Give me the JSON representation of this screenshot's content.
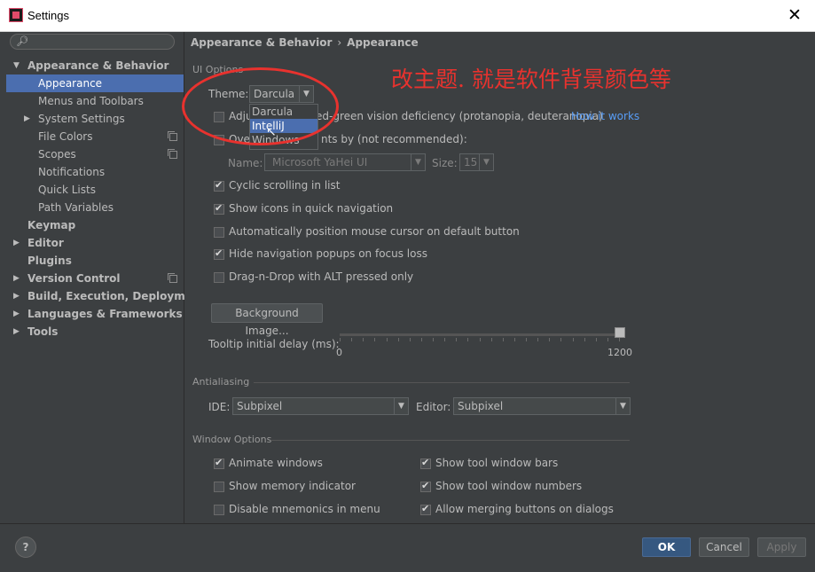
{
  "window": {
    "title": "Settings",
    "close_glyph": "✕"
  },
  "sidebar": {
    "search_placeholder": "",
    "items": [
      {
        "label": "Appearance & Behavior",
        "arrow": "▼"
      },
      {
        "label": "Appearance"
      },
      {
        "label": "Menus and Toolbars"
      },
      {
        "label": "System Settings",
        "arrow": "▶"
      },
      {
        "label": "File Colors"
      },
      {
        "label": "Scopes"
      },
      {
        "label": "Notifications"
      },
      {
        "label": "Quick Lists"
      },
      {
        "label": "Path Variables"
      },
      {
        "label": "Keymap"
      },
      {
        "label": "Editor",
        "arrow": "▶"
      },
      {
        "label": "Plugins"
      },
      {
        "label": "Version Control",
        "arrow": "▶"
      },
      {
        "label": "Build, Execution, Deployment",
        "arrow": "▶"
      },
      {
        "label": "Languages & Frameworks",
        "arrow": "▶"
      },
      {
        "label": "Tools",
        "arrow": "▶"
      }
    ]
  },
  "breadcrumb": {
    "parent": "Appearance & Behavior",
    "sep": "›",
    "current": "Appearance"
  },
  "ui_options": {
    "group_label": "UI Options",
    "theme_label": "Theme:",
    "theme_value": "Darcula",
    "theme_options": [
      "Darcula",
      "IntelliJ",
      "Windows"
    ],
    "adjust_prefix": "Adju",
    "adjust_suffix": "ed-green vision deficiency (protanopia, deuteranopia)",
    "how_it_works": "How it works",
    "override_prefix": "Over",
    "override_suffix": "nts by (not recommended):",
    "name_label": "Name:",
    "font_name": "Microsoft YaHei UI",
    "size_label": "Size:",
    "font_size": "15",
    "cyclic": "Cyclic scrolling in list",
    "show_icons": "Show icons in quick navigation",
    "auto_position": "Automatically position mouse cursor on default button",
    "hide_popups": "Hide navigation popups on focus loss",
    "drag_drop": "Drag-n-Drop with ALT pressed only",
    "background_image": "Background Image...",
    "tooltip_label": "Tooltip initial delay (ms):",
    "slider_min": "0",
    "slider_max": "1200",
    "slider_value": 1200
  },
  "antialiasing": {
    "group_label": "Antialiasing",
    "ide_label": "IDE:",
    "ide_value": "Subpixel",
    "editor_label": "Editor:",
    "editor_value": "Subpixel"
  },
  "window_options": {
    "group_label": "Window Options",
    "animate": "Animate windows",
    "memory": "Show memory indicator",
    "mnemonics": "Disable mnemonics in menu",
    "tool_bars": "Show tool window bars",
    "tool_numbers": "Show tool window numbers",
    "merging": "Allow merging buttons on dialogs"
  },
  "annotation": {
    "text": "改主题. 就是软件背景颜色等",
    "color": "#e8322e"
  },
  "footer": {
    "help": "?",
    "ok": "OK",
    "cancel": "Cancel",
    "apply": "Apply"
  },
  "colors": {
    "background": "#3c3f41",
    "selection": "#4b6eaf",
    "link": "#589df6"
  }
}
